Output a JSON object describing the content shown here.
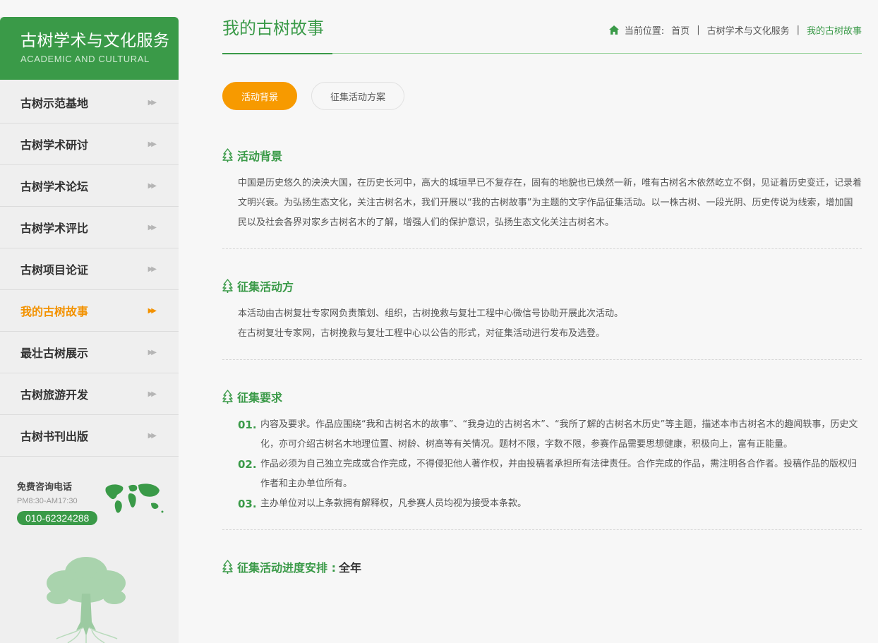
{
  "sidebar": {
    "title": "古树学术与文化服务",
    "subtitle": "ACADEMIC AND CULTURAL",
    "items": [
      {
        "label": "古树示范基地"
      },
      {
        "label": "古树学术研讨"
      },
      {
        "label": "古树学术论坛"
      },
      {
        "label": "古树学术评比"
      },
      {
        "label": "古树项目论证"
      },
      {
        "label": "我的古树故事",
        "active": true
      },
      {
        "label": "最壮古树展示"
      },
      {
        "label": "古树旅游开发"
      },
      {
        "label": "古树书刊出版"
      }
    ],
    "contact": {
      "title": "免费咨询电话",
      "hours": "PM8:30-AM17:30",
      "phone": "010-62324288"
    }
  },
  "header": {
    "title": "我的古树故事",
    "breadcrumb": {
      "prefix": "当前位置:",
      "home": "首页",
      "category": "古树学术与文化服务",
      "current": "我的古树故事"
    }
  },
  "tabs": [
    {
      "label": "活动背景",
      "active": true
    },
    {
      "label": "征集活动方案",
      "active": false
    }
  ],
  "sections": {
    "background": {
      "title": "活动背景",
      "text": "中国是历史悠久的泱泱大国，在历史长河中，高大的城垣早已不复存在，固有的地貌也已焕然一新，唯有古树名木依然屹立不倒，见证着历史变迁，记录着文明兴衰。为弘扬生态文化，关注古树名木，我们开展以“我的古树故事”为主题的文字作品征集活动。以一株古树、一段光阴、历史传说为线索，增加国民以及社会各界对家乡古树名木的了解，增强人们的保护意识，弘扬生态文化关注古树名木。"
    },
    "organizer": {
      "title": "征集活动方",
      "line1": "本活动由古树复壮专家网负责策划、组织，古树挽救与复壮工程中心微信号协助开展此次活动。",
      "line2": "在古树复壮专家网，古树挽救与复壮工程中心以公告的形式，对征集活动进行发布及选登。"
    },
    "requirements": {
      "title": "征集要求",
      "items": [
        {
          "num": "01.",
          "text": "内容及要求。作品应围绕“我和古树名木的故事”、“我身边的古树名木”、“我所了解的古树名木历史”等主题，描述本市古树名木的趣闻轶事，历史文化，亦可介绍古树名木地理位置、树龄、树高等有关情况。题材不限，字数不限，参赛作品需要思想健康，积极向上，富有正能量。"
        },
        {
          "num": "02.",
          "text": "作品必须为自己独立完成或合作完成，不得侵犯他人著作权，并由投稿者承担所有法律责任。合作完成的作品，需注明各合作者。投稿作品的版权归作者和主办单位所有。"
        },
        {
          "num": "03.",
          "text": "主办单位对以上条款拥有解释权，凡参赛人员均视为接受本条款。"
        }
      ]
    },
    "schedule": {
      "title": "征集活动进度安排 :",
      "value": "全年"
    }
  },
  "colors": {
    "brand_green": "#3a9a48",
    "accent_orange": "#f79a00"
  }
}
